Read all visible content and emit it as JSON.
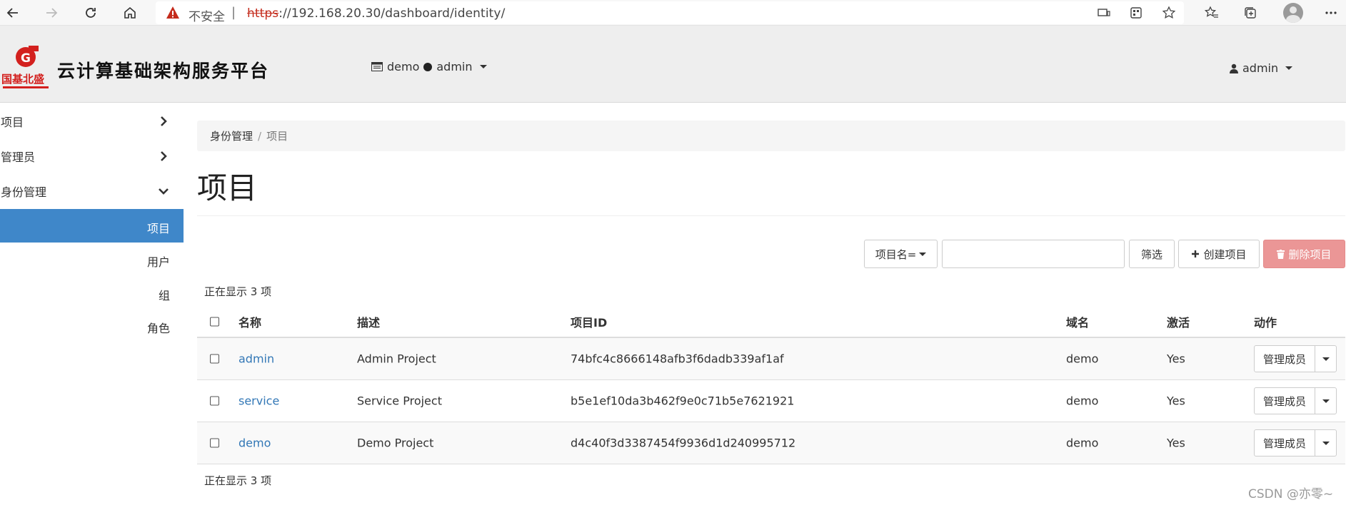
{
  "browser": {
    "insecure_label": "不安全",
    "separator": "|",
    "url_scheme": "https",
    "url_rest": "://192.168.20.30/dashboard/identity/"
  },
  "header": {
    "brand": "云计算基础架构服务平台",
    "logo_text": "国基北盛",
    "project": "demo",
    "region": "admin",
    "user": "admin"
  },
  "sidebar": {
    "items": [
      {
        "label": "项目"
      },
      {
        "label": "管理员"
      },
      {
        "label": "身份管理"
      }
    ],
    "sub_items": [
      {
        "label": "项目",
        "active": true
      },
      {
        "label": "用户"
      },
      {
        "label": "组"
      },
      {
        "label": "角色"
      }
    ]
  },
  "breadcrumb": {
    "parent": "身份管理",
    "separator": "/",
    "current": "项目"
  },
  "page": {
    "title": "项目"
  },
  "toolbar": {
    "filter_select": "项目名=",
    "filter_value": "",
    "filter_button": "筛选",
    "create_button": "创建项目",
    "delete_button": "删除项目"
  },
  "table": {
    "count_top": "正在显示 3 项",
    "count_bottom": "正在显示 3 项",
    "columns": {
      "name": "名称",
      "description": "描述",
      "project_id": "项目ID",
      "domain": "域名",
      "enabled": "激活",
      "actions": "动作"
    },
    "rows": [
      {
        "name": "admin",
        "description": "Admin Project",
        "project_id": "74bfc4c8666148afb3f6dadb339af1af",
        "domain": "demo",
        "enabled": "Yes",
        "action": "管理成员"
      },
      {
        "name": "service",
        "description": "Service Project",
        "project_id": "b5e1ef10da3b462f9e0c71b5e7621921",
        "domain": "demo",
        "enabled": "Yes",
        "action": "管理成员"
      },
      {
        "name": "demo",
        "description": "Demo Project",
        "project_id": "d4c40f3d3387454f9936d1d240995712",
        "domain": "demo",
        "enabled": "Yes",
        "action": "管理成员"
      }
    ]
  },
  "watermark": "CSDN @亦零~",
  "colors": {
    "accent": "#3f87c9",
    "link": "#3277b6",
    "danger": "#eb9696",
    "warning": "#c42b1c"
  }
}
